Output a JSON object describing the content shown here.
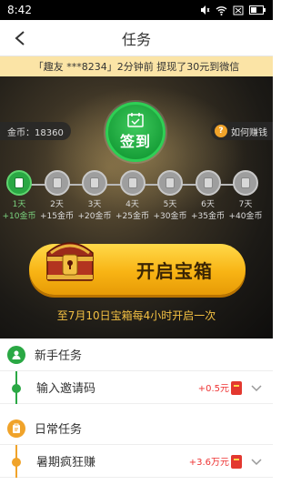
{
  "status_bar": {
    "time": "8:42"
  },
  "nav": {
    "title": "任务"
  },
  "notice": {
    "text": "「趣友 ***8234」2分钟前 提现了30元到微信"
  },
  "hero": {
    "gold_label": "金币：18360",
    "how_earn_label": "如何赚钱",
    "signin_label": "签到",
    "days": [
      {
        "day": "1天",
        "reward": "+10金币",
        "active": true
      },
      {
        "day": "2天",
        "reward": "+15金币",
        "active": false
      },
      {
        "day": "3天",
        "reward": "+20金币",
        "active": false
      },
      {
        "day": "4天",
        "reward": "+25金币",
        "active": false
      },
      {
        "day": "5天",
        "reward": "+30金币",
        "active": false
      },
      {
        "day": "6天",
        "reward": "+35金币",
        "active": false
      },
      {
        "day": "7天",
        "reward": "+40金币",
        "active": false
      }
    ],
    "chest_button_label": "开启宝箱",
    "chest_hint": "至7月10日宝箱每4小时开启一次"
  },
  "sections": {
    "newbie": {
      "title": "新手任务",
      "color": "#2aa844",
      "tasks": [
        {
          "name": "输入邀请码",
          "reward": "+0.5元"
        }
      ]
    },
    "daily": {
      "title": "日常任务",
      "color": "#f0a32a",
      "tasks": [
        {
          "name": "暑期疯狂赚",
          "reward": "+3.6万元"
        }
      ]
    }
  }
}
